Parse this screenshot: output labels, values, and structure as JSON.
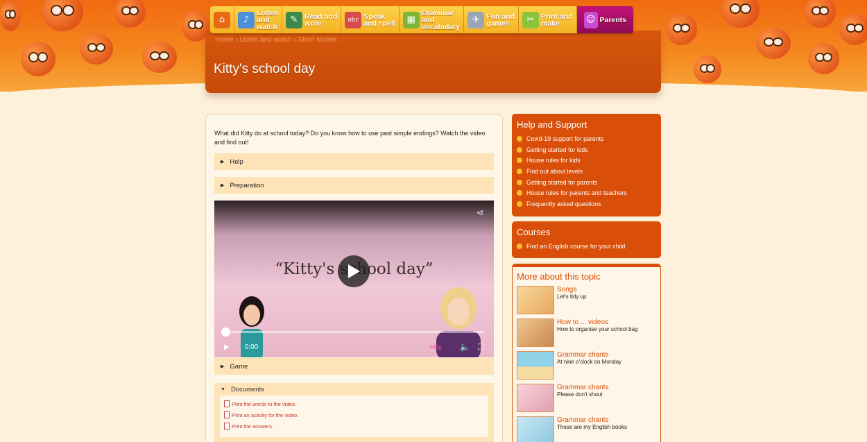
{
  "nav": [
    {
      "label": "",
      "icon": "home-icon",
      "bg": "#e86a12"
    },
    {
      "label": "Listen\nand\nwatch",
      "icon": "listen-icon",
      "bg": "#4a8fd8"
    },
    {
      "label": "Read and\nwrite",
      "icon": "read-icon",
      "bg": "#3c8a4a"
    },
    {
      "label": "Speak\nand spell",
      "icon": "abc-icon",
      "bg": "#d84b4b"
    },
    {
      "label": "Grammar\nand\nvocabulary",
      "icon": "grammar-icon",
      "bg": "#7bb53a"
    },
    {
      "label": "Fun and\ngames",
      "icon": "games-icon",
      "bg": "#9aa6b6"
    },
    {
      "label": "Print and\nmake",
      "icon": "print-icon",
      "bg": "#8ac43a"
    },
    {
      "label": "Parents",
      "icon": "parents-icon",
      "bg": "#c94bd0"
    }
  ],
  "page": {
    "breadcrumb": "Home › Listen and watch › Short stories",
    "title": "Kitty's school day",
    "intro": "What did Kitty do at school today? Do you know how to use past simple endings? Watch the video and find out!"
  },
  "accordions": {
    "help": "Help",
    "preparation": "Preparation",
    "game": "Game",
    "documents": "Documents"
  },
  "video": {
    "title": "“Kitty's school day”",
    "time": "0:00",
    "quality": "480p"
  },
  "documents": [
    "Print the words to the video.",
    "Print an activity for the video.",
    "Print the answers."
  ],
  "help_support": {
    "title": "Help and Support",
    "links": [
      "Covid-19 support for parents",
      "Getting started for kids",
      "House rules for kids",
      "Find out about levels",
      "Getting started for parents",
      "House rules for parents and teachers",
      "Frequently asked questions"
    ]
  },
  "courses": {
    "title": "Courses",
    "links": [
      "Find an English course for your child"
    ]
  },
  "more_topic": {
    "title": "More about this topic",
    "items": [
      {
        "category": "Songs",
        "title": "Let's tidy up",
        "thumb": "#f4c27a"
      },
      {
        "category": "How to ... videos",
        "title": "How to organise your school bag",
        "thumb": "#e8b06a"
      },
      {
        "category": "Grammar chants",
        "title": "At nine o'clock on Monday",
        "thumb": "#8fd2e8"
      },
      {
        "category": "Grammar chants",
        "title": "Please don't shout",
        "thumb": "#f0c0c8"
      },
      {
        "category": "Grammar chants",
        "title": "These are my English books",
        "thumb": "#b8e0f0"
      }
    ]
  },
  "colors": {
    "accent": "#d94e08",
    "nav_gold": "#f6b222",
    "parents": "#8e0a55"
  }
}
